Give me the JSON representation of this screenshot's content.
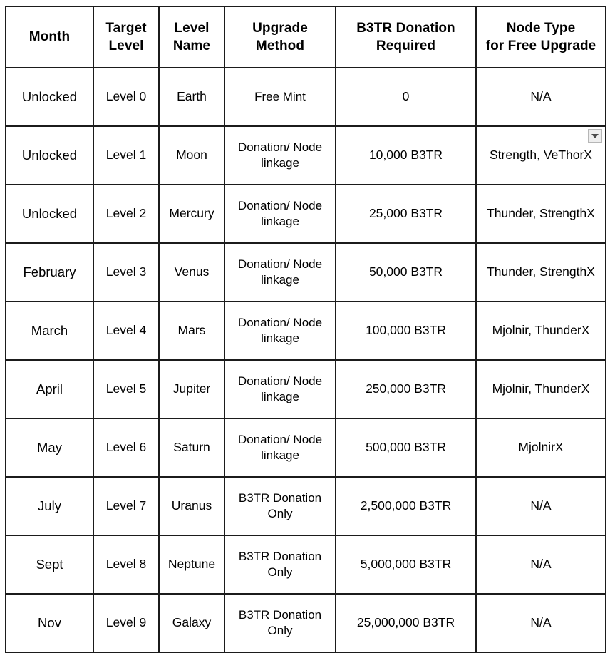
{
  "table": {
    "name": "node-upgrade-schedule",
    "columns": [
      {
        "key": "month",
        "label": "Month"
      },
      {
        "key": "target",
        "label": "Target\nLevel"
      },
      {
        "key": "lname",
        "label": "Level\nName"
      },
      {
        "key": "method",
        "label": "Upgrade\nMethod"
      },
      {
        "key": "donate",
        "label": "B3TR Donation\nRequired"
      },
      {
        "key": "node",
        "label": "Node Type\nfor Free Upgrade"
      }
    ],
    "headers": {
      "month": "Month",
      "target_line1": "Target",
      "target_line2": "Level",
      "lname_line1": "Level",
      "lname_line2": "Name",
      "method_line1": "Upgrade",
      "method_line2": "Method",
      "donate_line1": "B3TR Donation",
      "donate_line2": "Required",
      "node_line1": "Node Type",
      "node_line2": "for Free Upgrade"
    },
    "rows": [
      {
        "month": "Unlocked",
        "target": "Level 0",
        "lname": "Earth",
        "method": "Free Mint",
        "donate": "0",
        "node": "N/A"
      },
      {
        "month": "Unlocked",
        "target": "Level 1",
        "lname": "Moon",
        "method": "Donation/ Node linkage",
        "donate": "10,000 B3TR",
        "node": "Strength, VeThorX"
      },
      {
        "month": "Unlocked",
        "target": "Level 2",
        "lname": "Mercury",
        "method": "Donation/ Node linkage",
        "donate": "25,000 B3TR",
        "node": "Thunder, StrengthX"
      },
      {
        "month": "February",
        "target": "Level 3",
        "lname": "Venus",
        "method": "Donation/ Node linkage",
        "donate": "50,000 B3TR",
        "node": "Thunder, StrengthX"
      },
      {
        "month": "March",
        "target": "Level 4",
        "lname": "Mars",
        "method": "Donation/ Node linkage",
        "donate": "100,000 B3TR",
        "node": "Mjolnir, ThunderX"
      },
      {
        "month": "April",
        "target": "Level 5",
        "lname": "Jupiter",
        "method": "Donation/ Node linkage",
        "donate": "250,000 B3TR",
        "node": "Mjolnir, ThunderX"
      },
      {
        "month": "May",
        "target": "Level 6",
        "lname": "Saturn",
        "method": "Donation/ Node linkage",
        "donate": "500,000 B3TR",
        "node": "MjolnirX"
      },
      {
        "month": "July",
        "target": "Level 7",
        "lname": "Uranus",
        "method": "B3TR Donation Only",
        "donate": "2,500,000 B3TR",
        "node": "N/A"
      },
      {
        "month": "Sept",
        "target": "Level 8",
        "lname": "Neptune",
        "method": "B3TR Donation Only",
        "donate": "5,000,000 B3TR",
        "node": "N/A"
      },
      {
        "month": "Nov",
        "target": "Level 9",
        "lname": "Galaxy",
        "method": "B3TR Donation Only",
        "donate": "25,000,000 B3TR",
        "node": "N/A"
      }
    ]
  },
  "overlay": {
    "dropdown": {
      "icon": "caret-down-icon",
      "row_index": 1,
      "column": "node",
      "glyph": "▾"
    }
  },
  "colors": {
    "border": "#1b1b1b",
    "text": "#000000",
    "background": "#ffffff",
    "chip_fill": "#eeeeee",
    "chip_border": "#b6b6b6",
    "chip_glyph": "#4a4a4a"
  }
}
